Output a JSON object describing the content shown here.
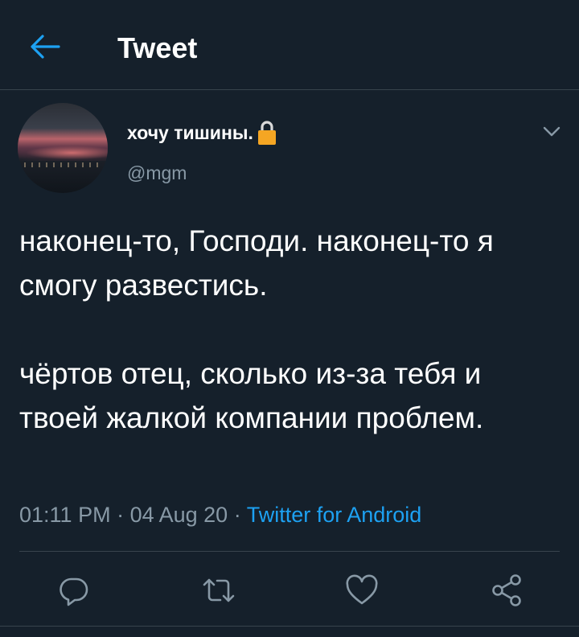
{
  "header": {
    "title": "Tweet",
    "back_icon": "arrow-left-icon"
  },
  "colors": {
    "background": "#15202b",
    "accent": "#1da1f2",
    "secondary_text": "#8899a6",
    "divider": "#38444d",
    "lock": "#f5a623"
  },
  "tweet": {
    "display_name": "хочу тишины.",
    "protected_icon": "lock-icon",
    "handle": "@mgm",
    "options_icon": "chevron-down-icon",
    "text_paragraph_1": "наконец-то, Господи. наконец-то я смогу развестись.",
    "text_paragraph_2": "чёртов отец, сколько из-за тебя и твоей жалкой компании проблем.",
    "time": "01:11 PM",
    "separator_1": " · ",
    "date": "04 Aug 20",
    "separator_2": " · ",
    "source": "Twitter for Android"
  },
  "actions": {
    "reply_icon": "reply-icon",
    "retweet_icon": "retweet-icon",
    "like_icon": "heart-icon",
    "share_icon": "share-icon"
  }
}
